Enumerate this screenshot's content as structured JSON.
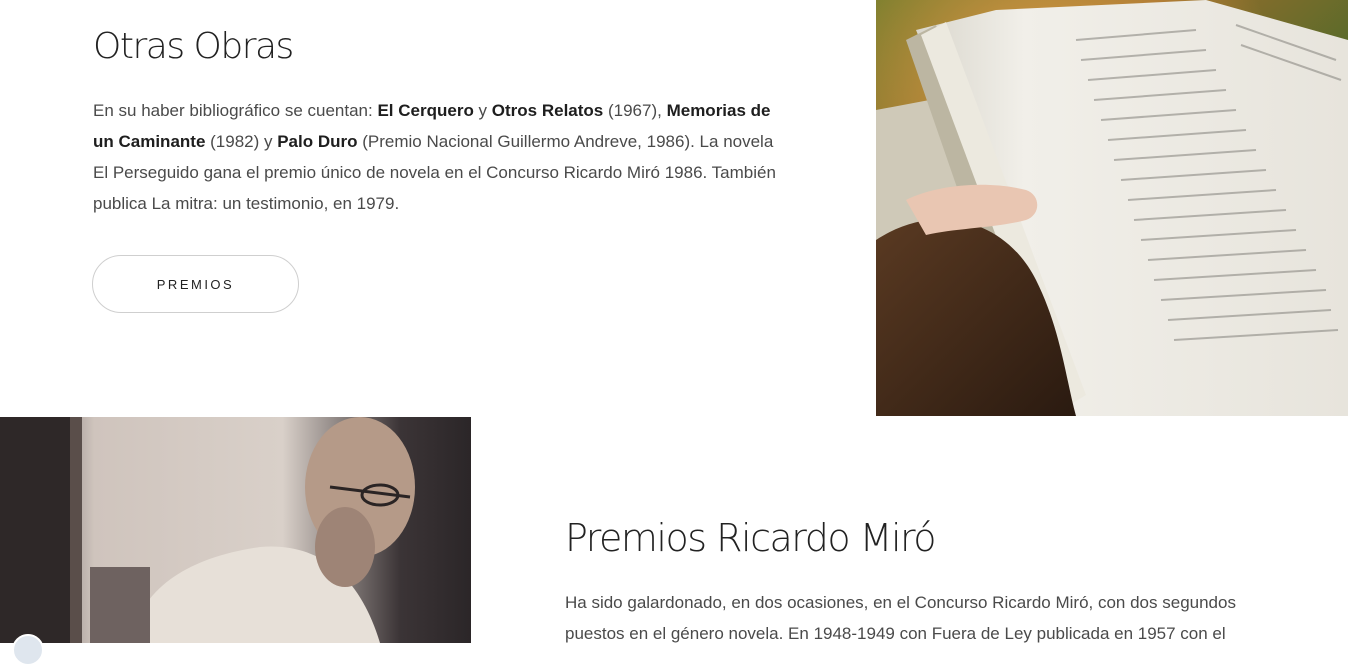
{
  "otras_obras": {
    "title": "Otras Obras",
    "paragraph": [
      {
        "text": "En su haber bibliográfico se cuentan: ",
        "bold": false
      },
      {
        "text": "El Cerquero",
        "bold": true
      },
      {
        "text": " y ",
        "bold": false
      },
      {
        "text": "Otros Relatos",
        "bold": true
      },
      {
        "text": " (1967), ",
        "bold": false
      },
      {
        "text": "Memorias de un Caminante",
        "bold": true
      },
      {
        "text": " (1982) y ",
        "bold": false
      },
      {
        "text": "Palo Duro",
        "bold": true
      },
      {
        "text": " (Premio Nacional Guillermo Andreve, 1986). La novela El Perseguido gana el premio único de novela en el Concurso Ricardo Miró 1986. También publica La mitra: un testimonio, en 1979.",
        "bold": false
      }
    ],
    "button_label": "PREMIOS"
  },
  "premios": {
    "title": "Premios Ricardo Miró",
    "paragraph": "Ha sido galardonado, en dos ocasiones, en el Concurso Ricardo Miró, con dos segundos puestos en el género novela. En 1948-1949 con Fuera de Ley publicada en 1957 con el"
  },
  "images": {
    "book_photo": "open-book-reading-photo",
    "author_photo": "author-portrait-photo"
  },
  "colors": {
    "title": "#222222",
    "text": "#4a4a4a",
    "bold_text": "#1e1e1e",
    "button_border": "#cfcfcf"
  }
}
